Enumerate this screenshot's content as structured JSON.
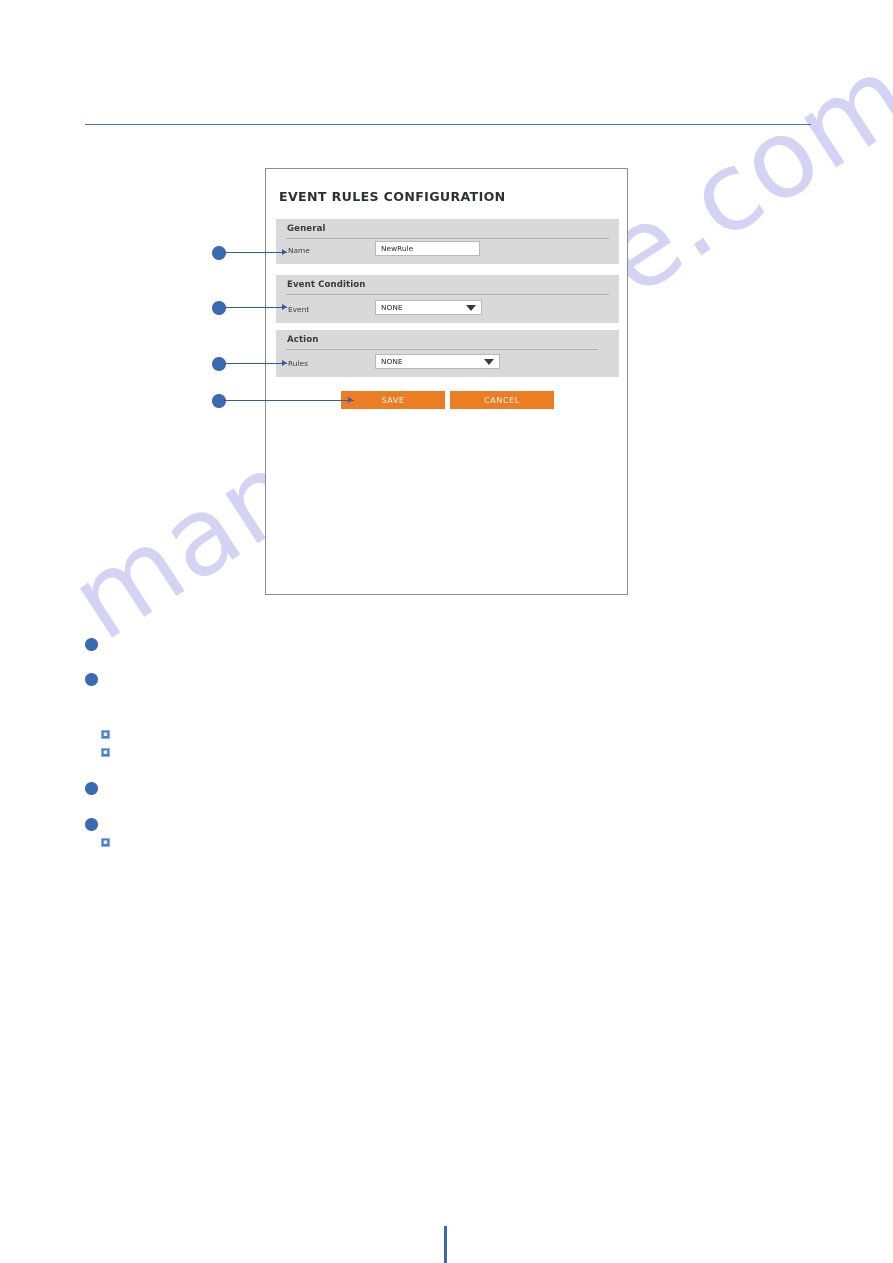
{
  "page": {
    "watermark": "manualshive.com"
  },
  "panel": {
    "title": "EVENT RULES CONFIGURATION",
    "sections": [
      {
        "title": "General",
        "field_label": "Name",
        "control": "text",
        "value": "NewRule",
        "placeholder": "NewRule"
      },
      {
        "title": "Event Condition",
        "field_label": "Event",
        "control": "select",
        "value": "NONE"
      },
      {
        "title": "Action",
        "field_label": "Rules",
        "control": "select",
        "value": "NONE"
      }
    ],
    "buttons": {
      "save": "SAVE",
      "cancel": "CANCEL"
    },
    "icons": {
      "caret": "chevron-down-icon"
    }
  },
  "callouts": [
    {
      "target": "name-field"
    },
    {
      "target": "event-field"
    },
    {
      "target": "rules-field"
    },
    {
      "target": "save-button"
    }
  ],
  "body": {
    "bullets": [
      "",
      "",
      "",
      ""
    ],
    "sub_icons": [
      "",
      "",
      ""
    ]
  },
  "colors": {
    "accent_blue": "#3a6bb0",
    "rule_blue": "#4a73a8",
    "button_orange": "#ed7d22",
    "section_gray": "#d9d9d9",
    "panel_border": "#8d8d8d",
    "watermark": "#ccccf2"
  }
}
